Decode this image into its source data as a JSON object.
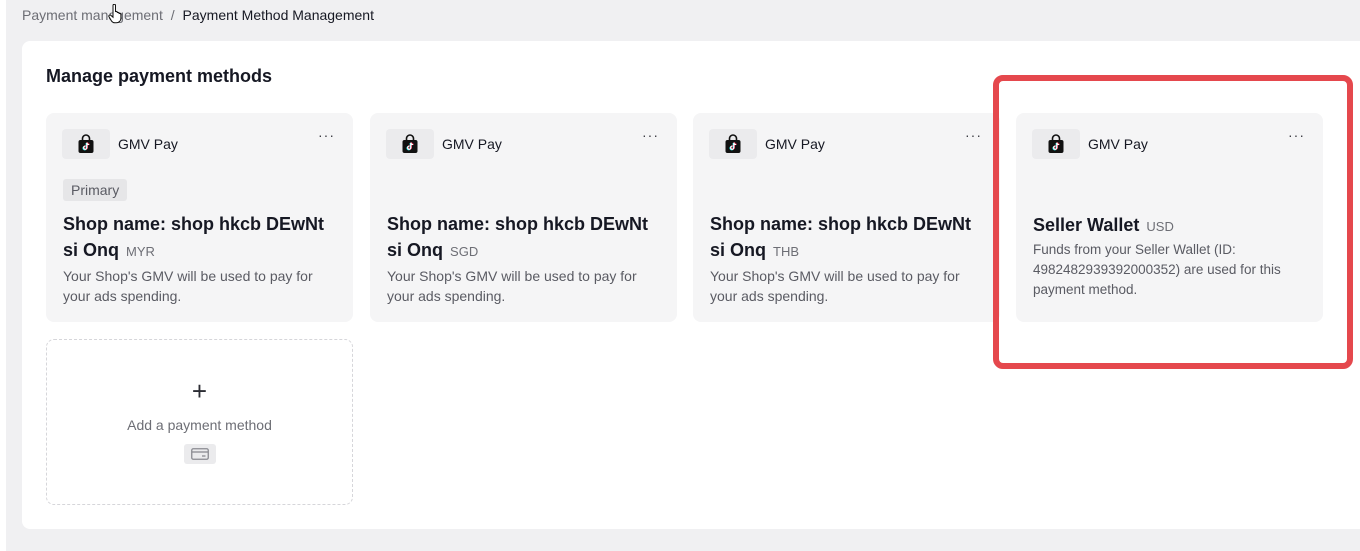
{
  "breadcrumb": {
    "parent": "Payment management",
    "separator": "/",
    "current": "Payment Method Management"
  },
  "panel": {
    "title": "Manage payment methods"
  },
  "cards": [
    {
      "brand": "GMV Pay",
      "more": "···",
      "badge": "Primary",
      "name": "Shop name: shop hkcb DEwNt si Onq",
      "currency": "MYR",
      "description": "Your Shop's GMV will be used to pay for your ads spending."
    },
    {
      "brand": "GMV Pay",
      "more": "···",
      "name": "Shop name: shop hkcb DEwNt si Onq",
      "currency": "SGD",
      "description": "Your Shop's GMV will be used to pay for your ads spending."
    },
    {
      "brand": "GMV Pay",
      "more": "···",
      "name": "Shop name: shop hkcb DEwNt si Onq",
      "currency": "THB",
      "description": "Your Shop's GMV will be used to pay for your ads spending."
    },
    {
      "brand": "GMV Pay",
      "more": "···",
      "name": "Seller Wallet",
      "currency": "USD",
      "description": "Funds from your Seller Wallet (ID: 4982482939392000352) are used for this payment method."
    }
  ],
  "add_card": {
    "plus": "+",
    "label": "Add a payment method",
    "icon": "credit-card-icon"
  },
  "colors": {
    "highlight": "#e5484d",
    "card_bg": "#f5f5f6",
    "page_bg": "#f0f0f2"
  },
  "icons": {
    "brand_logo": "tiktok-shop-bag-icon",
    "cursor": "hand-pointer-icon"
  }
}
